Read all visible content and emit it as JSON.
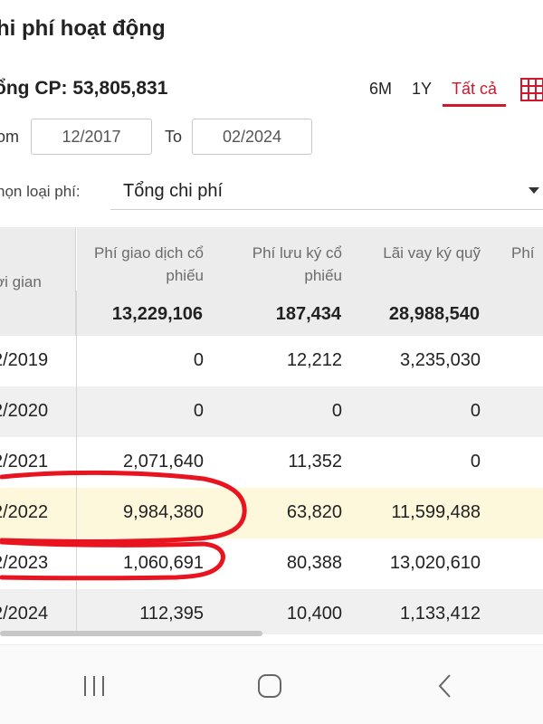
{
  "page": {
    "title": "hi phí hoạt động",
    "total": "ổng CP: 53,805,831"
  },
  "periods": [
    {
      "label": "6M",
      "active": false
    },
    {
      "label": "1Y",
      "active": false
    },
    {
      "label": "Tất cả",
      "active": true
    }
  ],
  "range": {
    "from_label": "om",
    "from_value": "12/2017",
    "to_label": "To",
    "to_value": "02/2024"
  },
  "filter": {
    "label": "họn loại phí:",
    "value": "Tổng chi phí"
  },
  "table": {
    "headers": {
      "time": "ời gian",
      "c1": "Phí giao dịch cổ phiếu",
      "c2": "Phí lưu ký cổ phiếu",
      "c3": "Lãi vay ký quỹ",
      "c4": "Phí"
    },
    "totals": [
      "13,229,106",
      "187,434",
      "28,988,540"
    ],
    "rows": [
      {
        "time": "2/2019",
        "c1": "0",
        "c2": "12,212",
        "c3": "3,235,030"
      },
      {
        "time": "2/2020",
        "c1": "0",
        "c2": "0",
        "c3": "0"
      },
      {
        "time": "2/2021",
        "c1": "2,071,640",
        "c2": "11,352",
        "c3": "0"
      },
      {
        "time": "2/2022",
        "c1": "9,984,380",
        "c2": "63,820",
        "c3": "11,599,488"
      },
      {
        "time": "2/2023",
        "c1": "1,060,691",
        "c2": "80,388",
        "c3": "13,020,610"
      },
      {
        "time": "2/2024",
        "c1": "112,395",
        "c2": "10,400",
        "c3": "1,133,412"
      }
    ]
  },
  "colors": {
    "accent": "#d0182a",
    "highlight_row": "#fdf8dc",
    "annotation": "#e8141f"
  }
}
